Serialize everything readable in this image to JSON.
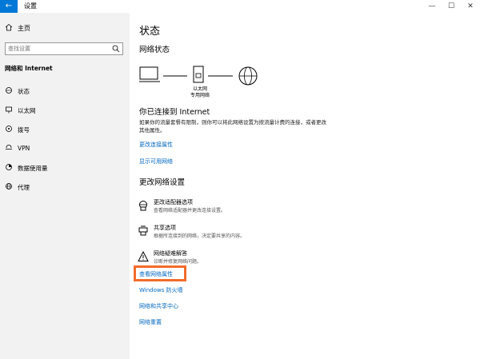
{
  "window": {
    "title": "设置",
    "back_icon": "back-arrow-icon",
    "controls": [
      "—",
      "☐",
      "✕"
    ]
  },
  "sidebar": {
    "home": {
      "label": "主页",
      "icon": "home-icon"
    },
    "search": {
      "placeholder": "查找设置",
      "value": "",
      "icon": "search-icon"
    },
    "section": "网络和 Internet",
    "items": [
      {
        "label": "状态",
        "icon": "status-icon"
      },
      {
        "label": "以太网",
        "icon": "ethernet-icon"
      },
      {
        "label": "拨号",
        "icon": "dialup-icon"
      },
      {
        "label": "VPN",
        "icon": "vpn-icon"
      },
      {
        "label": "数据使用量",
        "icon": "data-usage-icon"
      },
      {
        "label": "代理",
        "icon": "proxy-icon"
      }
    ]
  },
  "main": {
    "title": "状态",
    "network_status": "网络状态",
    "diagram": {
      "label_line1": "以太网",
      "label_line2": "专用网络"
    },
    "connected_title": "你已连接到 Internet",
    "connected_desc": "如果你的流量套餐有限制，则你可以将此网络设置为按流量计费的连接，或者更改其他属性。",
    "links_top": [
      "更改连接属性",
      "显示可用网络"
    ],
    "change_title": "更改网络设置",
    "options": [
      {
        "title": "更改适配器选项",
        "desc": "查看网络适配器并更改连接设置。",
        "icon": "adapter-icon"
      },
      {
        "title": "共享选项",
        "desc": "根据所连接到的网络，决定要共享的内容。",
        "icon": "sharing-icon"
      },
      {
        "title": "网络疑难解答",
        "desc": "诊断并修复网络问题。",
        "icon": "warning-icon"
      }
    ],
    "links_bottom": [
      "查看网络属性",
      "Windows 防火墙",
      "网络和共享中心",
      "网络重置"
    ],
    "accent_color": "#0067c0",
    "highlight_color": "#f26c2b"
  }
}
